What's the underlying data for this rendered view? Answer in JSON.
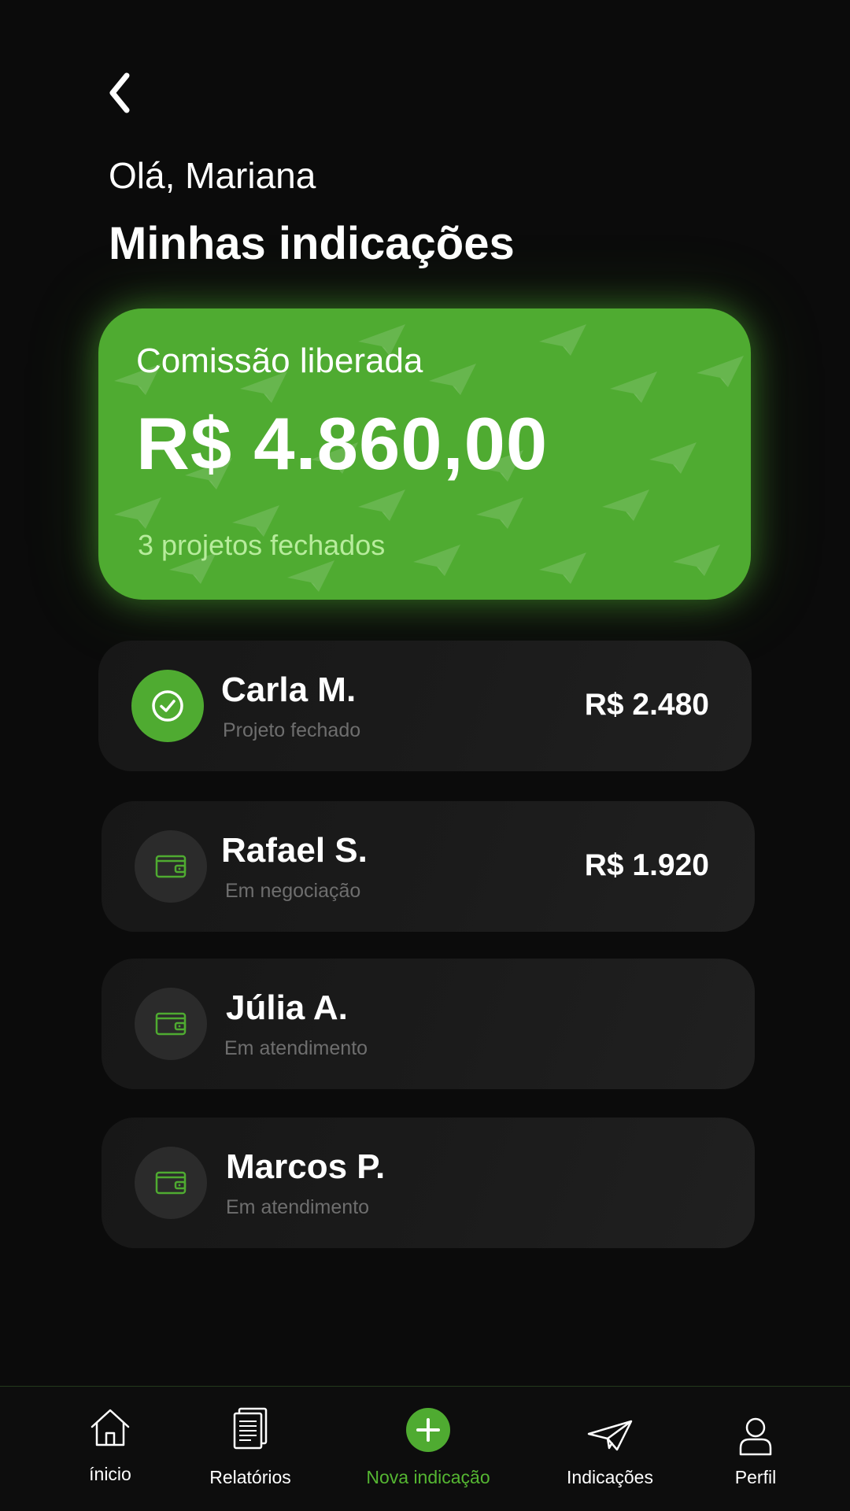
{
  "header": {
    "greeting": "Olá, Mariana",
    "title": "Minhas indicações"
  },
  "summary": {
    "label": "Comissão liberada",
    "value": "R$ 4.860,00",
    "subtitle": "3 projetos fechados"
  },
  "referrals": [
    {
      "name": "Carla M.",
      "status": "Projeto fechado",
      "amount": "R$ 2.480",
      "icon": "check-icon",
      "closed": true
    },
    {
      "name": "Rafael S.",
      "status": "Em negociação",
      "amount": "R$ 1.920",
      "icon": "wallet-icon",
      "closed": false
    },
    {
      "name": "Júlia A.",
      "status": "Em atendimento",
      "amount": "",
      "icon": "wallet-icon",
      "closed": false
    },
    {
      "name": "Marcos P.",
      "status": "Em atendimento",
      "amount": "",
      "icon": "wallet-icon",
      "closed": false
    }
  ],
  "nav": {
    "items": [
      {
        "label": "ínicio",
        "icon": "home-icon"
      },
      {
        "label": "Relatórios",
        "icon": "report-icon"
      },
      {
        "label": "Nova indicação",
        "icon": "plus-icon",
        "active": true
      },
      {
        "label": "Indicações",
        "icon": "paper-plane-icon"
      },
      {
        "label": "Perfil",
        "icon": "user-icon"
      }
    ]
  },
  "colors": {
    "background": "#0b0b0b",
    "accent": "#4fab31",
    "card": "#1a1a1a",
    "muted_text": "#6e6e6e",
    "summary_subtitle": "#b7ec9c"
  }
}
